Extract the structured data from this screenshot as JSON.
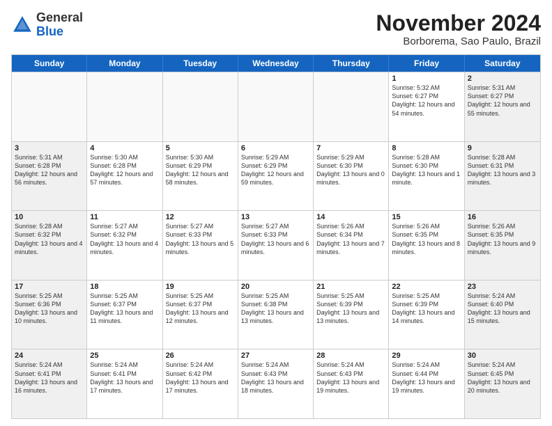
{
  "header": {
    "logo_general": "General",
    "logo_blue": "Blue",
    "month_title": "November 2024",
    "location": "Borborema, Sao Paulo, Brazil"
  },
  "days_of_week": [
    "Sunday",
    "Monday",
    "Tuesday",
    "Wednesday",
    "Thursday",
    "Friday",
    "Saturday"
  ],
  "weeks": [
    {
      "cells": [
        {
          "day": "",
          "empty": true
        },
        {
          "day": "",
          "empty": true
        },
        {
          "day": "",
          "empty": true
        },
        {
          "day": "",
          "empty": true
        },
        {
          "day": "",
          "empty": true
        },
        {
          "day": "1",
          "sunrise": "Sunrise: 5:32 AM",
          "sunset": "Sunset: 6:27 PM",
          "daylight": "Daylight: 12 hours and 54 minutes."
        },
        {
          "day": "2",
          "sunrise": "Sunrise: 5:31 AM",
          "sunset": "Sunset: 6:27 PM",
          "daylight": "Daylight: 12 hours and 55 minutes."
        }
      ]
    },
    {
      "cells": [
        {
          "day": "3",
          "sunrise": "Sunrise: 5:31 AM",
          "sunset": "Sunset: 6:28 PM",
          "daylight": "Daylight: 12 hours and 56 minutes."
        },
        {
          "day": "4",
          "sunrise": "Sunrise: 5:30 AM",
          "sunset": "Sunset: 6:28 PM",
          "daylight": "Daylight: 12 hours and 57 minutes."
        },
        {
          "day": "5",
          "sunrise": "Sunrise: 5:30 AM",
          "sunset": "Sunset: 6:29 PM",
          "daylight": "Daylight: 12 hours and 58 minutes."
        },
        {
          "day": "6",
          "sunrise": "Sunrise: 5:29 AM",
          "sunset": "Sunset: 6:29 PM",
          "daylight": "Daylight: 12 hours and 59 minutes."
        },
        {
          "day": "7",
          "sunrise": "Sunrise: 5:29 AM",
          "sunset": "Sunset: 6:30 PM",
          "daylight": "Daylight: 13 hours and 0 minutes."
        },
        {
          "day": "8",
          "sunrise": "Sunrise: 5:28 AM",
          "sunset": "Sunset: 6:30 PM",
          "daylight": "Daylight: 13 hours and 1 minute."
        },
        {
          "day": "9",
          "sunrise": "Sunrise: 5:28 AM",
          "sunset": "Sunset: 6:31 PM",
          "daylight": "Daylight: 13 hours and 3 minutes."
        }
      ]
    },
    {
      "cells": [
        {
          "day": "10",
          "sunrise": "Sunrise: 5:28 AM",
          "sunset": "Sunset: 6:32 PM",
          "daylight": "Daylight: 13 hours and 4 minutes."
        },
        {
          "day": "11",
          "sunrise": "Sunrise: 5:27 AM",
          "sunset": "Sunset: 6:32 PM",
          "daylight": "Daylight: 13 hours and 4 minutes."
        },
        {
          "day": "12",
          "sunrise": "Sunrise: 5:27 AM",
          "sunset": "Sunset: 6:33 PM",
          "daylight": "Daylight: 13 hours and 5 minutes."
        },
        {
          "day": "13",
          "sunrise": "Sunrise: 5:27 AM",
          "sunset": "Sunset: 6:33 PM",
          "daylight": "Daylight: 13 hours and 6 minutes."
        },
        {
          "day": "14",
          "sunrise": "Sunrise: 5:26 AM",
          "sunset": "Sunset: 6:34 PM",
          "daylight": "Daylight: 13 hours and 7 minutes."
        },
        {
          "day": "15",
          "sunrise": "Sunrise: 5:26 AM",
          "sunset": "Sunset: 6:35 PM",
          "daylight": "Daylight: 13 hours and 8 minutes."
        },
        {
          "day": "16",
          "sunrise": "Sunrise: 5:26 AM",
          "sunset": "Sunset: 6:35 PM",
          "daylight": "Daylight: 13 hours and 9 minutes."
        }
      ]
    },
    {
      "cells": [
        {
          "day": "17",
          "sunrise": "Sunrise: 5:25 AM",
          "sunset": "Sunset: 6:36 PM",
          "daylight": "Daylight: 13 hours and 10 minutes."
        },
        {
          "day": "18",
          "sunrise": "Sunrise: 5:25 AM",
          "sunset": "Sunset: 6:37 PM",
          "daylight": "Daylight: 13 hours and 11 minutes."
        },
        {
          "day": "19",
          "sunrise": "Sunrise: 5:25 AM",
          "sunset": "Sunset: 6:37 PM",
          "daylight": "Daylight: 13 hours and 12 minutes."
        },
        {
          "day": "20",
          "sunrise": "Sunrise: 5:25 AM",
          "sunset": "Sunset: 6:38 PM",
          "daylight": "Daylight: 13 hours and 13 minutes."
        },
        {
          "day": "21",
          "sunrise": "Sunrise: 5:25 AM",
          "sunset": "Sunset: 6:39 PM",
          "daylight": "Daylight: 13 hours and 13 minutes."
        },
        {
          "day": "22",
          "sunrise": "Sunrise: 5:25 AM",
          "sunset": "Sunset: 6:39 PM",
          "daylight": "Daylight: 13 hours and 14 minutes."
        },
        {
          "day": "23",
          "sunrise": "Sunrise: 5:24 AM",
          "sunset": "Sunset: 6:40 PM",
          "daylight": "Daylight: 13 hours and 15 minutes."
        }
      ]
    },
    {
      "cells": [
        {
          "day": "24",
          "sunrise": "Sunrise: 5:24 AM",
          "sunset": "Sunset: 6:41 PM",
          "daylight": "Daylight: 13 hours and 16 minutes."
        },
        {
          "day": "25",
          "sunrise": "Sunrise: 5:24 AM",
          "sunset": "Sunset: 6:41 PM",
          "daylight": "Daylight: 13 hours and 17 minutes."
        },
        {
          "day": "26",
          "sunrise": "Sunrise: 5:24 AM",
          "sunset": "Sunset: 6:42 PM",
          "daylight": "Daylight: 13 hours and 17 minutes."
        },
        {
          "day": "27",
          "sunrise": "Sunrise: 5:24 AM",
          "sunset": "Sunset: 6:43 PM",
          "daylight": "Daylight: 13 hours and 18 minutes."
        },
        {
          "day": "28",
          "sunrise": "Sunrise: 5:24 AM",
          "sunset": "Sunset: 6:43 PM",
          "daylight": "Daylight: 13 hours and 19 minutes."
        },
        {
          "day": "29",
          "sunrise": "Sunrise: 5:24 AM",
          "sunset": "Sunset: 6:44 PM",
          "daylight": "Daylight: 13 hours and 19 minutes."
        },
        {
          "day": "30",
          "sunrise": "Sunrise: 5:24 AM",
          "sunset": "Sunset: 6:45 PM",
          "daylight": "Daylight: 13 hours and 20 minutes."
        }
      ]
    }
  ]
}
